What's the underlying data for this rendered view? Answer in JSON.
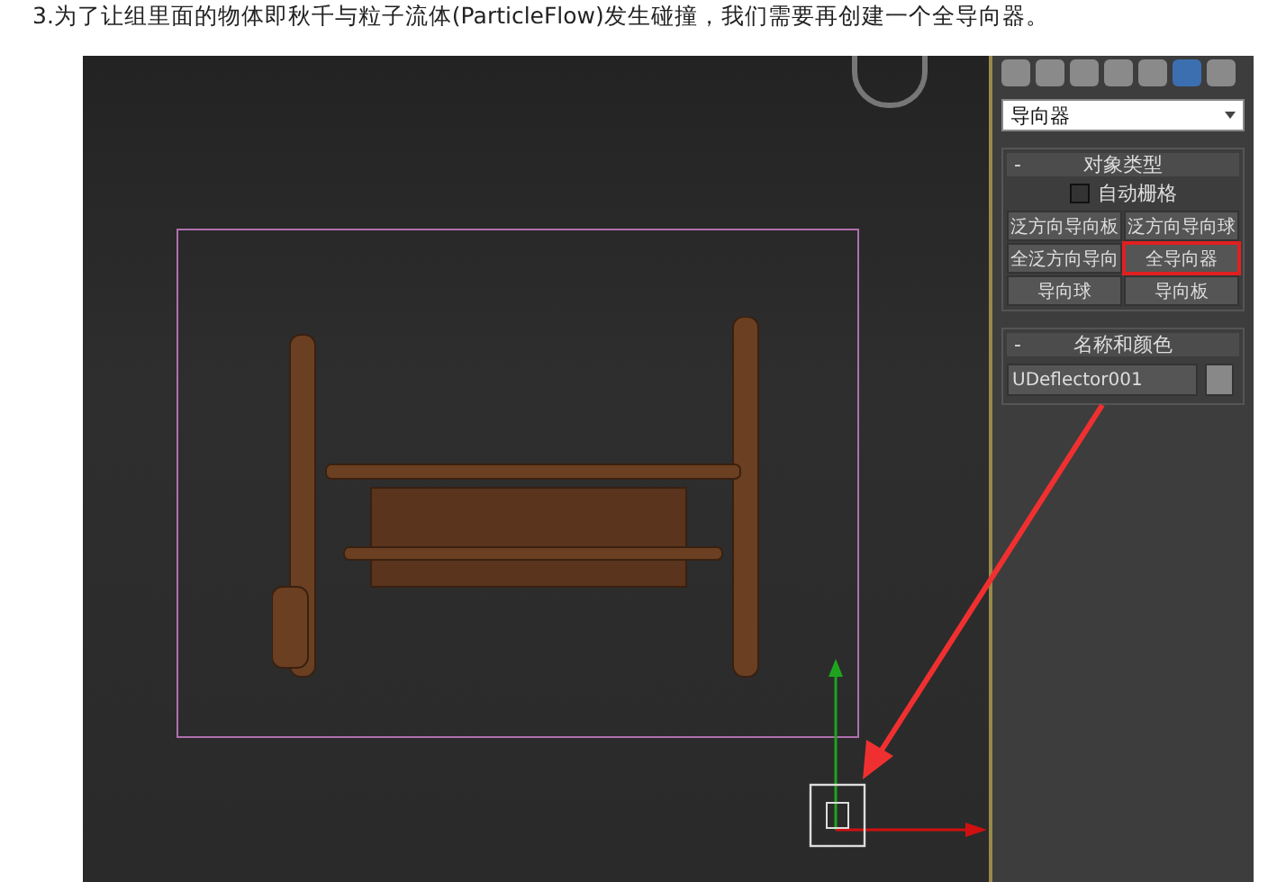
{
  "caption": "3.为了让组里面的物体即秋千与粒子流体(ParticleFlow)发生碰撞，我们需要再创建一个全导向器。",
  "panel": {
    "category": "导向器",
    "object_type": {
      "collapse": "-",
      "title": "对象类型",
      "auto_grid": {
        "label": "自动栅格",
        "checked": false
      },
      "buttons": [
        {
          "label": "泛方向导向板",
          "selected": false
        },
        {
          "label": "泛方向导向球",
          "selected": false
        },
        {
          "label": "全泛方向导向",
          "selected": false
        },
        {
          "label": "全导向器",
          "selected": true
        },
        {
          "label": "导向球",
          "selected": false
        },
        {
          "label": "导向板",
          "selected": false
        }
      ]
    },
    "name_color": {
      "collapse": "-",
      "title": "名称和颜色",
      "name": "UDeflector001"
    }
  }
}
